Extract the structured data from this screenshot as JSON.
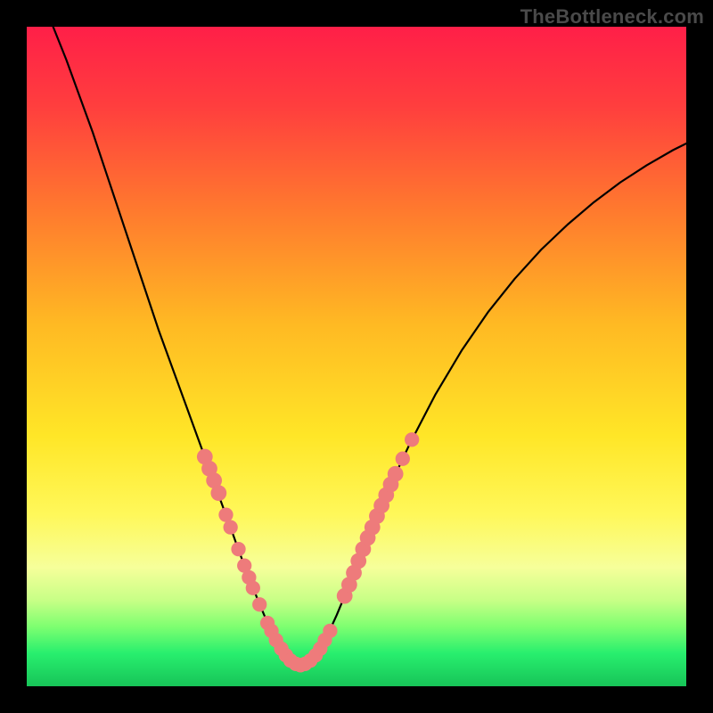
{
  "watermark": "TheBottleneck.com",
  "colors": {
    "frame": "#000000",
    "curve_stroke": "#000000",
    "marker_fill": "#ee7b7b",
    "gradient_stops": [
      {
        "offset": "0%",
        "color": "#ff1f48"
      },
      {
        "offset": "12%",
        "color": "#ff3e3e"
      },
      {
        "offset": "28%",
        "color": "#ff7a2e"
      },
      {
        "offset": "45%",
        "color": "#ffb923"
      },
      {
        "offset": "62%",
        "color": "#ffe627"
      },
      {
        "offset": "74%",
        "color": "#fff85a"
      },
      {
        "offset": "82%",
        "color": "#f6ff9a"
      },
      {
        "offset": "87%",
        "color": "#c7ff86"
      },
      {
        "offset": "91%",
        "color": "#7dff70"
      },
      {
        "offset": "95%",
        "color": "#28ef6e"
      },
      {
        "offset": "100%",
        "color": "#17c458"
      }
    ]
  },
  "chart_data": {
    "type": "line",
    "title": "",
    "xlabel": "",
    "ylabel": "",
    "xlim": [
      0,
      100
    ],
    "ylim": [
      0,
      100
    ],
    "grid": false,
    "legend": false,
    "series": [
      {
        "name": "curve",
        "x": [
          4,
          6,
          8,
          10,
          12,
          14,
          16,
          18,
          20,
          22,
          24,
          26,
          28,
          30,
          31,
          32,
          33,
          34,
          35,
          36,
          37,
          38,
          39,
          40,
          41.5,
          43,
          44,
          45,
          46,
          47,
          48,
          49,
          50,
          52,
          55,
          58,
          62,
          66,
          70,
          74,
          78,
          82,
          86,
          90,
          94,
          98,
          100
        ],
        "y": [
          100,
          95,
          89.5,
          84,
          78,
          72,
          66,
          60,
          54,
          48.5,
          43,
          37.5,
          32,
          26.5,
          23.8,
          21,
          18.3,
          15.7,
          13.2,
          10.8,
          8.6,
          6.6,
          5.0,
          3.8,
          3.2,
          3.8,
          5.0,
          6.6,
          8.6,
          10.8,
          13.2,
          15.7,
          18.3,
          23.2,
          30.2,
          36.6,
          44.3,
          51.0,
          56.8,
          61.8,
          66.2,
          70.0,
          73.4,
          76.4,
          79.0,
          81.3,
          82.3
        ]
      }
    ],
    "markers": [
      {
        "x": 27.0,
        "y": 34.8,
        "r": 1.2
      },
      {
        "x": 27.7,
        "y": 33.0,
        "r": 1.2
      },
      {
        "x": 28.4,
        "y": 31.2,
        "r": 1.2
      },
      {
        "x": 29.1,
        "y": 29.3,
        "r": 1.2
      },
      {
        "x": 30.2,
        "y": 26.0,
        "r": 1.1
      },
      {
        "x": 30.9,
        "y": 24.1,
        "r": 1.1
      },
      {
        "x": 32.1,
        "y": 20.8,
        "r": 1.1
      },
      {
        "x": 33.0,
        "y": 18.3,
        "r": 1.1
      },
      {
        "x": 33.7,
        "y": 16.5,
        "r": 1.1
      },
      {
        "x": 34.3,
        "y": 14.9,
        "r": 1.1
      },
      {
        "x": 35.3,
        "y": 12.4,
        "r": 1.1
      },
      {
        "x": 36.5,
        "y": 9.6,
        "r": 1.1
      },
      {
        "x": 37.1,
        "y": 8.4,
        "r": 1.1
      },
      {
        "x": 37.8,
        "y": 7.0,
        "r": 1.1
      },
      {
        "x": 38.6,
        "y": 5.7,
        "r": 1.1
      },
      {
        "x": 39.3,
        "y": 4.7,
        "r": 1.1
      },
      {
        "x": 40.0,
        "y": 3.9,
        "r": 1.1
      },
      {
        "x": 40.8,
        "y": 3.4,
        "r": 1.1
      },
      {
        "x": 41.5,
        "y": 3.2,
        "r": 1.1
      },
      {
        "x": 42.2,
        "y": 3.4,
        "r": 1.1
      },
      {
        "x": 43.0,
        "y": 3.9,
        "r": 1.1
      },
      {
        "x": 43.8,
        "y": 4.7,
        "r": 1.1
      },
      {
        "x": 44.5,
        "y": 5.7,
        "r": 1.1
      },
      {
        "x": 45.2,
        "y": 7.0,
        "r": 1.1
      },
      {
        "x": 46.0,
        "y": 8.4,
        "r": 1.1
      },
      {
        "x": 48.2,
        "y": 13.7,
        "r": 1.2
      },
      {
        "x": 48.9,
        "y": 15.4,
        "r": 1.2
      },
      {
        "x": 49.6,
        "y": 17.2,
        "r": 1.2
      },
      {
        "x": 50.3,
        "y": 19.0,
        "r": 1.2
      },
      {
        "x": 51.0,
        "y": 20.8,
        "r": 1.2
      },
      {
        "x": 51.7,
        "y": 22.5,
        "r": 1.2
      },
      {
        "x": 52.4,
        "y": 24.1,
        "r": 1.2
      },
      {
        "x": 53.1,
        "y": 25.8,
        "r": 1.2
      },
      {
        "x": 53.8,
        "y": 27.4,
        "r": 1.2
      },
      {
        "x": 54.5,
        "y": 29.0,
        "r": 1.2
      },
      {
        "x": 55.2,
        "y": 30.6,
        "r": 1.2
      },
      {
        "x": 55.9,
        "y": 32.2,
        "r": 1.2
      },
      {
        "x": 57.0,
        "y": 34.5,
        "r": 1.1
      },
      {
        "x": 58.4,
        "y": 37.4,
        "r": 1.1
      }
    ]
  }
}
